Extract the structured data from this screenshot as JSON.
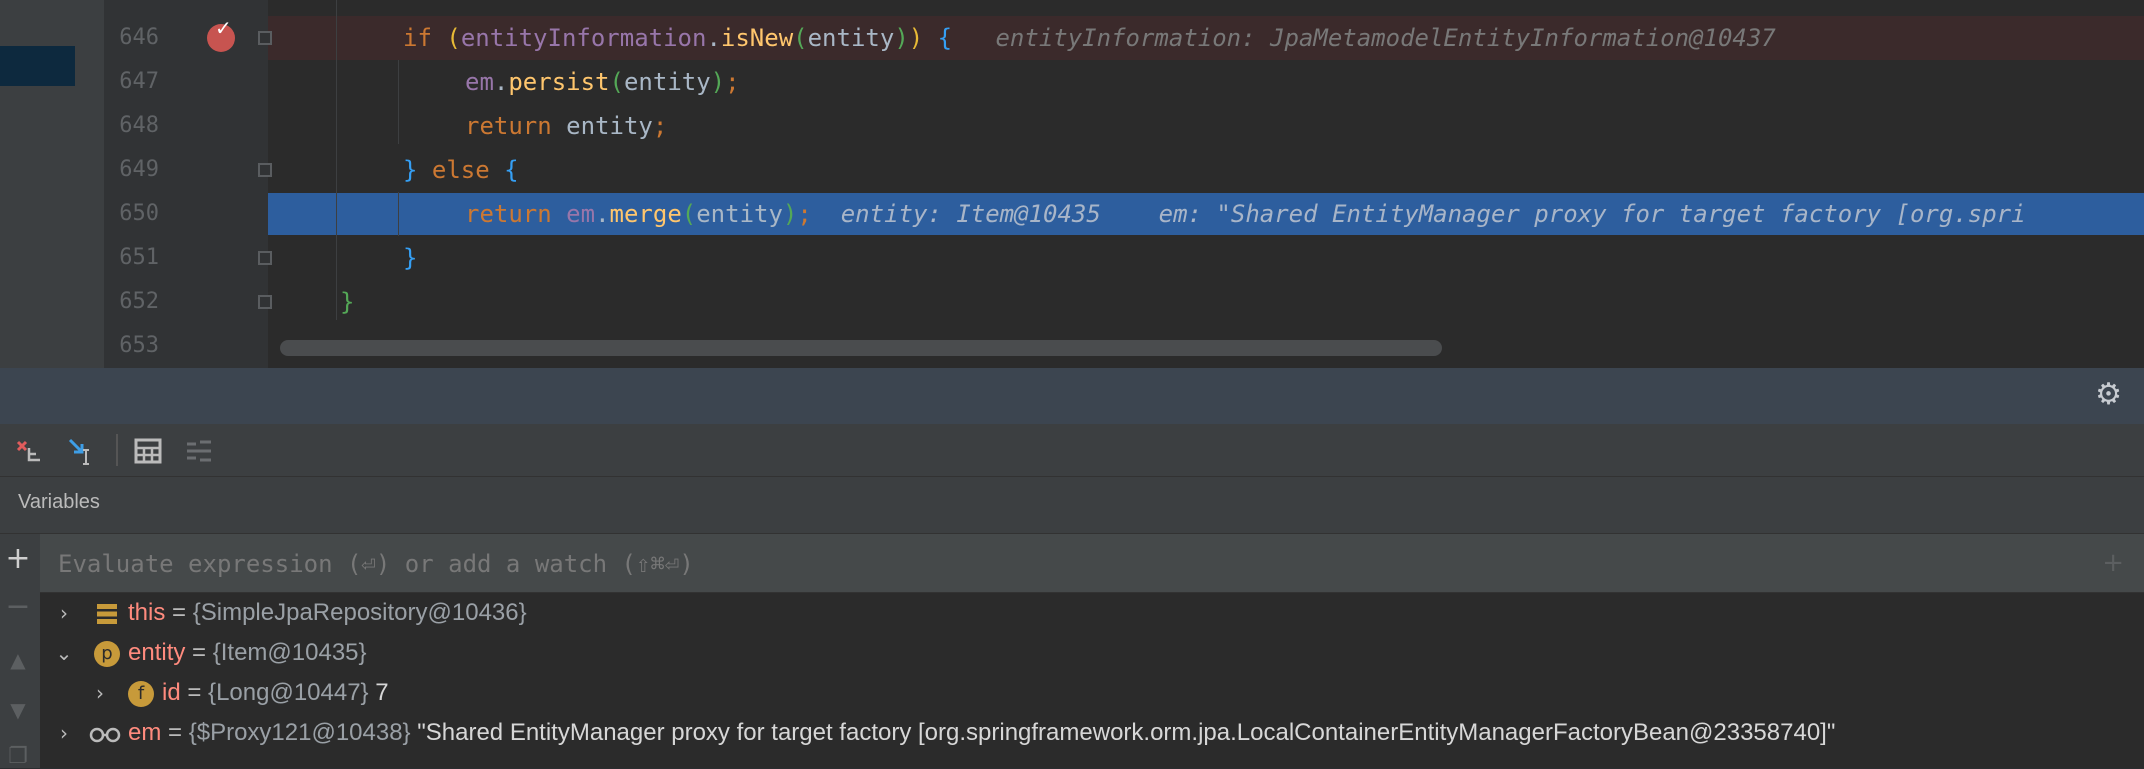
{
  "editor": {
    "lines": [
      {
        "num": "646"
      },
      {
        "num": "647"
      },
      {
        "num": "648"
      },
      {
        "num": "649"
      },
      {
        "num": "650"
      },
      {
        "num": "651"
      },
      {
        "num": "652"
      },
      {
        "num": "653"
      }
    ],
    "code": {
      "l646": {
        "kw_if": "if",
        "open": " (",
        "obj": "entityInformation",
        "dot": ".",
        "method": "isNew",
        "p1": "(",
        "arg": "entity",
        "p2": ")",
        "p3": ")",
        "brace": " {",
        "hint": "entityInformation: JpaMetamodelEntityInformation@10437"
      },
      "l647": {
        "field": "em",
        "dot": ".",
        "method": "persist",
        "p1": "(",
        "arg": "entity",
        "p2": ")",
        "semi": ";"
      },
      "l648": {
        "kw": "return",
        "rest": " entity",
        "semi": ";"
      },
      "l649": {
        "brace1": "}",
        "kw_else": " else ",
        "brace2": "{"
      },
      "l650": {
        "kw": "return",
        "field": " em",
        "dot": ".",
        "method": "merge",
        "p1": "(",
        "arg": "entity",
        "p2": ")",
        "semi": ";",
        "hint1": "entity: Item@10435",
        "hint2": "em: \"Shared EntityManager proxy for target factory [org.spri"
      },
      "l651": {
        "brace": "}"
      },
      "l652": {
        "brace": "}"
      }
    },
    "breakpoint_color": "#c75450",
    "execution_line_color": "#2d5e9e",
    "breakpoint_line_color": "#3b2a2b"
  },
  "panel": {
    "toolbar_icons": [
      "restore-layout-icon",
      "step-into-icon",
      "calculator-icon",
      "frames-icon"
    ],
    "settings_icon": "gear-icon",
    "variables_title": "Variables",
    "eval_placeholder": "Evaluate expression (⏎) or add a watch (⇧⌘⏎)",
    "side_icons": [
      "plus-icon",
      "minus-icon",
      "arrow-up-icon",
      "arrow-down-icon",
      "copy-icon"
    ],
    "variables": [
      {
        "name": "this",
        "eq": " = ",
        "type": "{SimpleJpaRepository@10436}",
        "value": "",
        "icon": "object-icon",
        "expanded": false
      },
      {
        "name": "entity",
        "eq": " = ",
        "type": "{Item@10435}",
        "value": "",
        "icon": "p",
        "expanded": true
      },
      {
        "name": "id",
        "eq": " = ",
        "type": "{Long@10447}",
        "value": " 7",
        "icon": "f",
        "expanded": false
      },
      {
        "name": "em",
        "eq": " = ",
        "type": "{$Proxy121@10438}",
        "value": " \"Shared EntityManager proxy for target factory [org.springframework.orm.jpa.LocalContainerEntityManagerFactoryBean@23358740]\"",
        "icon": "watch-glasses-icon",
        "expanded": false
      }
    ]
  }
}
